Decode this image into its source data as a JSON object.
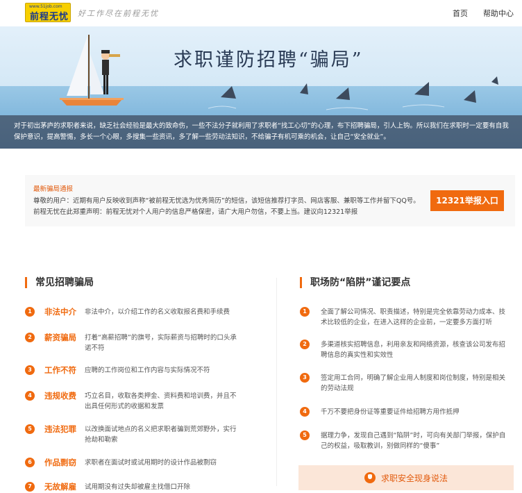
{
  "header": {
    "logo_url": "www.51job.com",
    "logo_text": "前程无忧",
    "slogan": "好工作尽在前程无忧",
    "nav": [
      "首页",
      "帮助中心"
    ]
  },
  "banner": {
    "title": "求职谨防招聘“骗局”",
    "text": "对于初出茅庐的求职者来说，缺乏社会经验是最大的致命伤，一些不法分子就利用了求职者“找工心切”的心理，布下招聘骗局，引人上钩。所以我们在求职时一定要有自我保护意识，提高警惕，多长一个心眼，多搜集一些资讯，多了解一些劳动法知识，不给骗子有机可乘的机会，让自己“安全就业”。"
  },
  "notice": {
    "title": "最新骗局通报",
    "body": "尊敬的用户：近期有用户反映收到声称“被前程无忧选为优秀简历”的短信，该短信推荐打字员、网店客服、兼职等工作并留下QQ号。前程无忧在此郑重声明：前程无忧对个人用户的信息严格保密，请广大用户勿信，不要上当。建议向12321举报",
    "button": "12321举报入口"
  },
  "left": {
    "title": "常见招聘骗局",
    "items": [
      {
        "num": "1",
        "name": "非法中介",
        "desc": "非法中介，以介绍工作的名义收取报名费和手续费"
      },
      {
        "num": "2",
        "name": "薪资骗局",
        "desc": "打着“高薪招聘”的旗号，实际薪资与招聘时的口头承诺不符"
      },
      {
        "num": "3",
        "name": "工作不符",
        "desc": "应聘的工作岗位和工作内容与实际情况不符"
      },
      {
        "num": "4",
        "name": "违规收费",
        "desc": "巧立名目，收取各类押金、资料费和培训费，并且不出具任何形式的收据和发票"
      },
      {
        "num": "5",
        "name": "违法犯罪",
        "desc": "以改换面试地点的名义把求职者骗到荒郊野外，实行抢劫和勒索"
      },
      {
        "num": "6",
        "name": "作品剽窃",
        "desc": "求职者在面试时或试用期时的设计作品被剽窃"
      },
      {
        "num": "7",
        "name": "无故解雇",
        "desc": "试用期没有过失却被雇主找借口开除"
      }
    ]
  },
  "right": {
    "title": "职场防“陷阱”谨记要点",
    "items": [
      {
        "num": "1",
        "desc": "全面了解公司情况、职责描述，特别是完全依靠劳动力成本、技术比较低的企业，在进入这样的企业前，一定要多方面打听"
      },
      {
        "num": "2",
        "desc": "多渠道核实招聘信息，利用亲友和网络资源，核查该公司发布招聘信息的真实性和实效性"
      },
      {
        "num": "3",
        "desc": "签定用工合同，明确了解企业用人制度和岗位制度，特别是相关的劳动法规"
      },
      {
        "num": "4",
        "desc": "千万不要把身份证等重要证件给招聘方用作抵押"
      },
      {
        "num": "5",
        "desc": "据理力争，发现自己遇到“陷阱”时，可向有关部门举报，保护自己的权益，吸取教训，别做同样的“傻事”"
      }
    ],
    "button": "求职安全现身说法"
  },
  "colors": {
    "accent": "#f06a0f",
    "banner_sea": "#6aa7d3",
    "title_dark": "#2a3b55"
  }
}
